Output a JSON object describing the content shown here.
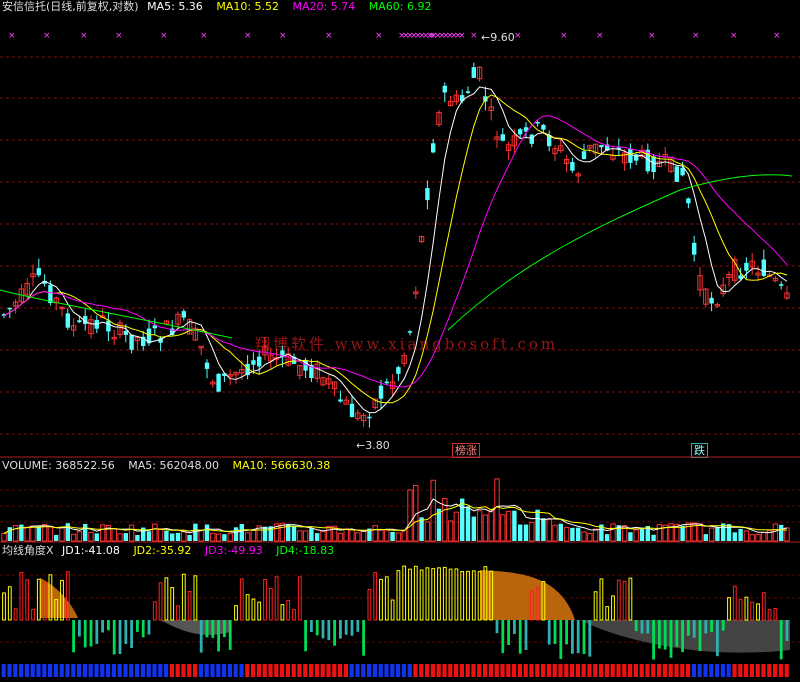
{
  "price_panel": {
    "stock_name": "安信信托(日线,前复权,对数)",
    "ma5_label": "MA5:",
    "ma5_value": "5.36",
    "ma10_label": "MA10:",
    "ma10_value": "5.52",
    "ma20_label": "MA20:",
    "ma20_value": "5.74",
    "ma60_label": "MA60:",
    "ma60_value": "6.92",
    "high_marker": "9.60",
    "low_marker": "3.80",
    "badge_left": "榜涨",
    "badge_right": "跌",
    "colors": {
      "ma5": "#ffffff",
      "ma10": "#ffff00",
      "ma20": "#ff00ff",
      "ma60": "#00ff00",
      "up": "#ff3232",
      "down": "#54ffff"
    }
  },
  "volume_panel": {
    "title": "VOLUME:",
    "value": "368522.56",
    "ma5_label": "MA5:",
    "ma5_value": "562048.00",
    "ma10_label": "MA10:",
    "ma10_value": "566630.38"
  },
  "indicator_panel": {
    "title": "均线角度X",
    "jd1_label": "JD1:",
    "jd1_value": "-41.08",
    "jd2_label": "JD2:",
    "jd2_value": "-35.92",
    "jd3_label": "JD3:",
    "jd3_value": "-49.93",
    "jd4_label": "JD4:",
    "jd4_value": "-18.83"
  },
  "watermark": "翔博软件 www.xiangbosoft.com",
  "chart_data": {
    "type": "candlestick",
    "title": "安信信托(日线,前复权,对数)",
    "y_high_marker": 9.6,
    "y_low_marker": 3.8,
    "moving_averages": {
      "MA5": 5.36,
      "MA10": 5.52,
      "MA20": 5.74,
      "MA60": 6.92
    },
    "volume": {
      "VOLUME": 368522.56,
      "MA5": 562048.0,
      "MA10": 566630.38
    },
    "indicator": {
      "JD1": -41.08,
      "JD2": -35.92,
      "JD3": -49.93,
      "JD4": -18.83
    }
  }
}
